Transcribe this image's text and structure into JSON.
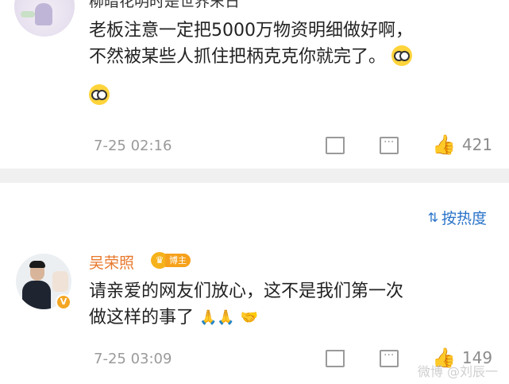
{
  "comment1": {
    "username_partial": "柳暗花明时是世界末日",
    "text_line1": "老板注意一定把5000万物资明细做好啊，",
    "text_line2": "不然被某些人抓住把柄克克你就完了。",
    "emoji": "emoji-glasses-face",
    "time": "7-25 02:16",
    "likes": "421"
  },
  "sort": {
    "label": "按热度",
    "icon": "sort-icon"
  },
  "comment2": {
    "username": "吴荣照",
    "badge": "博主",
    "verified": "V",
    "text_line1": "请亲爱的网友们放心，这不是我们第一次",
    "text_line2": "做这样的事了",
    "time": "7-25 03:09",
    "likes": "149"
  },
  "watermark": "微博 @刘辰一",
  "colors": {
    "accent": "#2a73c9",
    "username": "#e8782c",
    "badge": "#f6a11b",
    "meta": "#9a9a9a"
  }
}
